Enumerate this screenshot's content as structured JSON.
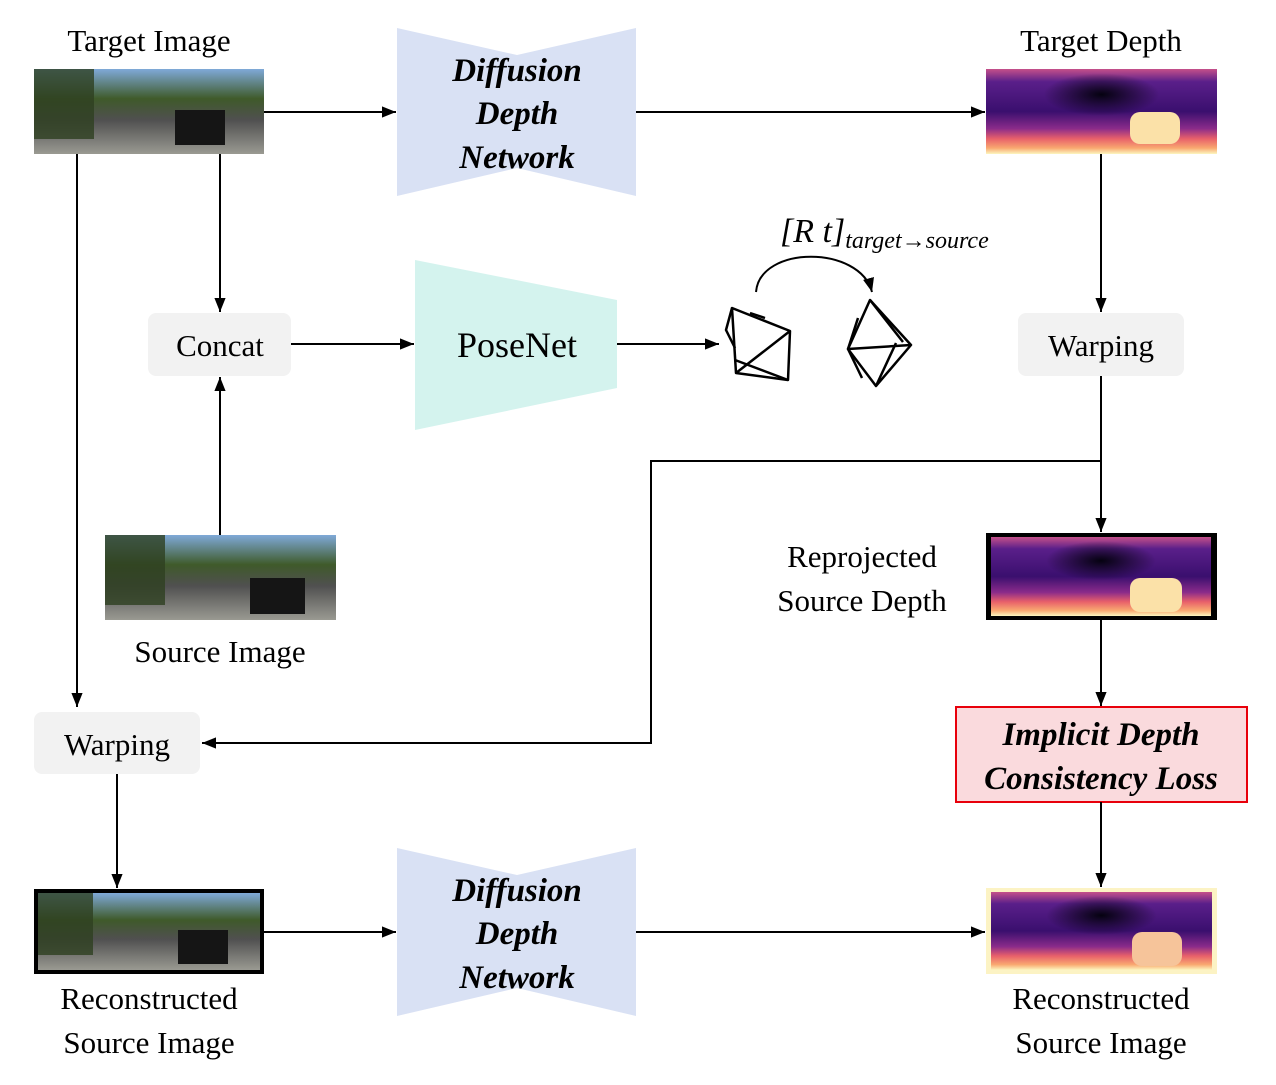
{
  "labels": {
    "target_image": "Target Image",
    "target_depth": "Target Depth",
    "source_image": "Source Image",
    "reprojected_1": "Reprojected",
    "reprojected_2": "Source Depth",
    "recon_image_1": "Reconstructed",
    "recon_image_2": "Source Image",
    "recon_depth_1": "Reconstructed",
    "recon_depth_2": "Source Image"
  },
  "nodes": {
    "diffusion_top": [
      "Diffusion",
      "Depth",
      "Network"
    ],
    "diffusion_bottom": [
      "Diffusion",
      "Depth",
      "Network"
    ],
    "concat": "Concat",
    "posenet": "PoseNet",
    "warping_right": "Warping",
    "warping_left": "Warping",
    "loss": [
      "Implicit Depth",
      "Consistency Loss"
    ]
  },
  "pose": {
    "main": "[R t]",
    "subscript": "target→source"
  },
  "colors": {
    "diffusion_fill": "#d9e1f4",
    "posenet_fill": "#d4f3ee",
    "box_fill": "#f2f2f2",
    "loss_fill": "#fadadd",
    "loss_border": "#e8000b"
  }
}
